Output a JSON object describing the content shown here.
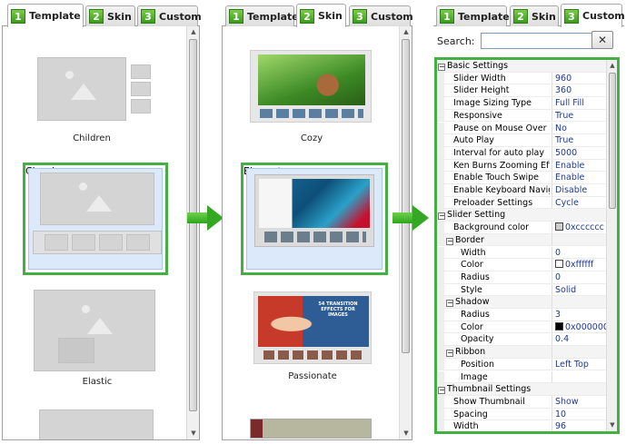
{
  "tabs": {
    "template": "Template",
    "skin": "Skin",
    "custom": "Custom",
    "n1": "1",
    "n2": "2",
    "n3": "3"
  },
  "templates": [
    {
      "label": "Children"
    },
    {
      "label": "Classic"
    },
    {
      "label": "Elastic"
    }
  ],
  "skins": [
    {
      "label": "Cozy"
    },
    {
      "label": "Elegant"
    },
    {
      "label": "Passionate"
    }
  ],
  "passionate_text": "54 TRANSITION EFFECTS FOR IMAGES",
  "search": {
    "label": "Search:",
    "value": "",
    "clear": "✕"
  },
  "colors": {
    "accent": "#44b044",
    "selection": "#dbe9fa",
    "value_text": "#1f3a93"
  },
  "properties": [
    {
      "name": "Basic Settings",
      "value": "",
      "cat": true,
      "level": 0
    },
    {
      "name": "Slider Width",
      "value": "960",
      "level": 1
    },
    {
      "name": "Slider Height",
      "value": "360",
      "level": 1
    },
    {
      "name": "Image Sizing Type",
      "value": "Full Fill",
      "level": 1
    },
    {
      "name": "Responsive",
      "value": "True",
      "level": 1
    },
    {
      "name": "Pause on Mouse Over",
      "value": "No",
      "level": 1
    },
    {
      "name": "Auto Play",
      "value": "True",
      "level": 1
    },
    {
      "name": "Interval for auto play",
      "value": "5000",
      "level": 1
    },
    {
      "name": "Ken Burns Zooming Effect",
      "value": "Enable",
      "level": 1
    },
    {
      "name": "Enable Touch Swipe",
      "value": "Enable",
      "level": 1
    },
    {
      "name": "Enable Keyboard Navig...",
      "value": "Disable",
      "level": 1
    },
    {
      "name": "Preloader Settings",
      "value": "Cycle",
      "level": 1
    },
    {
      "name": "Slider Setting",
      "value": "",
      "cat": true,
      "level": 0
    },
    {
      "name": "Background color",
      "value": "0xcccccc",
      "swatch": "#cccccc",
      "level": 1
    },
    {
      "name": "Border",
      "value": "",
      "cat": true,
      "level": 1
    },
    {
      "name": "Width",
      "value": "0",
      "level": 2
    },
    {
      "name": "Color",
      "value": "0xffffff",
      "swatch": "#ffffff",
      "level": 2
    },
    {
      "name": "Radius",
      "value": "0",
      "level": 2
    },
    {
      "name": "Style",
      "value": "Solid",
      "level": 2
    },
    {
      "name": "Shadow",
      "value": "",
      "cat": true,
      "level": 1
    },
    {
      "name": "Radius",
      "value": "3",
      "level": 2
    },
    {
      "name": "Color",
      "value": "0x000000",
      "swatch": "#000000",
      "level": 2
    },
    {
      "name": "Opacity",
      "value": "0.4",
      "level": 2
    },
    {
      "name": "Ribbon",
      "value": "",
      "cat": true,
      "level": 1
    },
    {
      "name": "Position",
      "value": "Left Top",
      "level": 2
    },
    {
      "name": "Image",
      "value": "",
      "level": 2
    },
    {
      "name": "Thumbnail Settings",
      "value": "",
      "cat": true,
      "level": 0
    },
    {
      "name": "Show Thumbnail",
      "value": "Show",
      "level": 1
    },
    {
      "name": "Spacing",
      "value": "10",
      "level": 1
    },
    {
      "name": "Width",
      "value": "96",
      "level": 1
    }
  ]
}
